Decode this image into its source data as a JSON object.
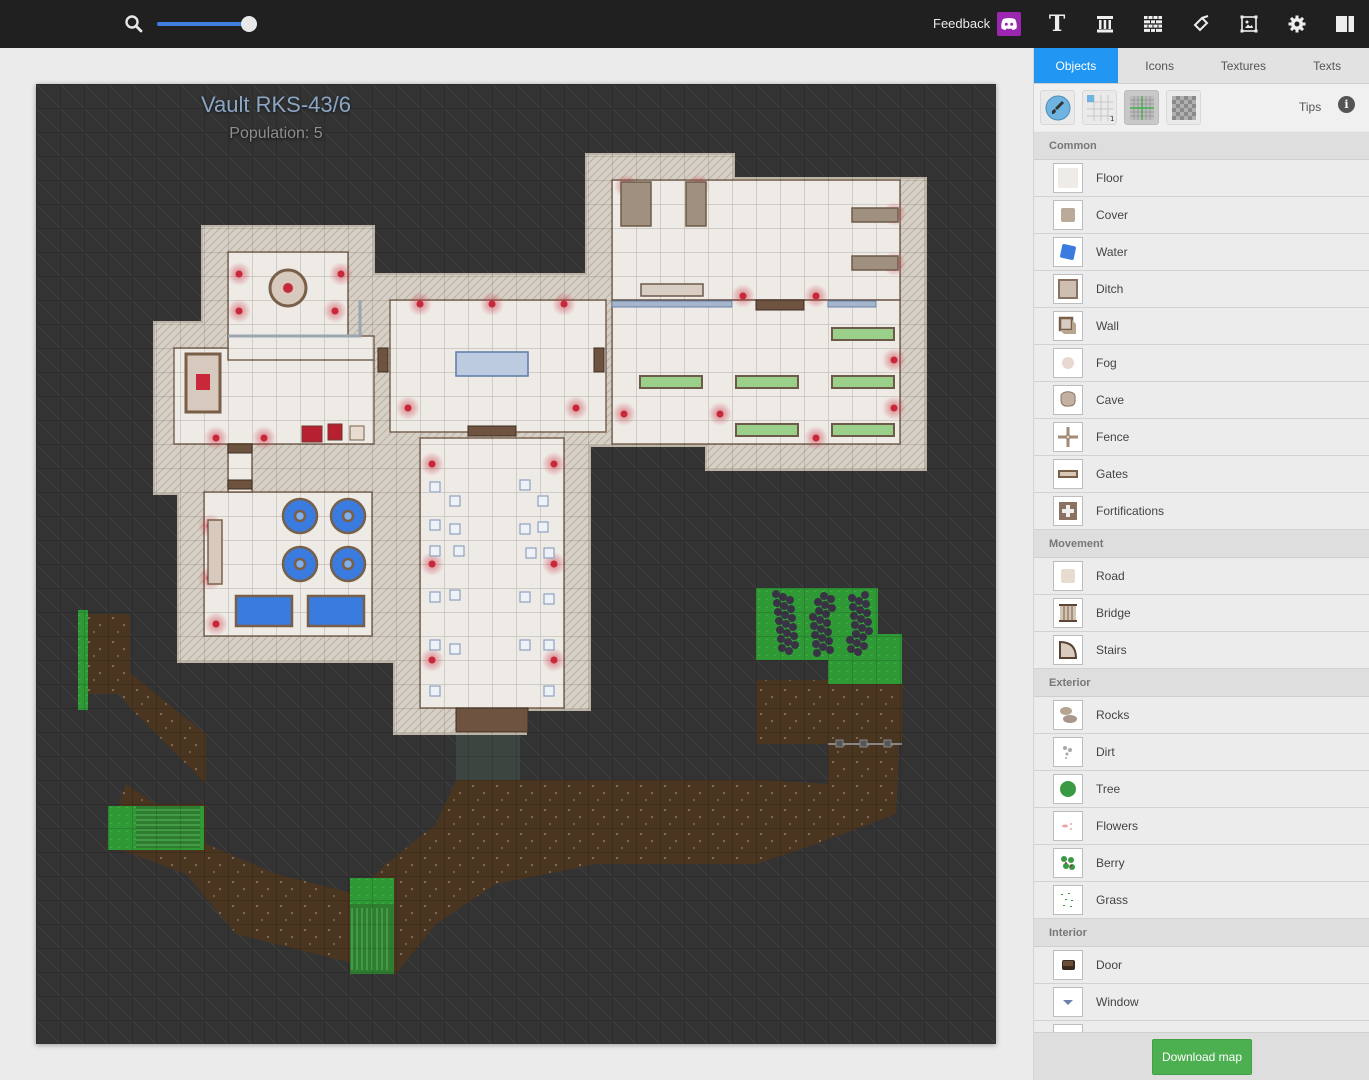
{
  "topbar": {
    "zoom_icon": "search-icon",
    "zoom_level_fraction": 0.92,
    "feedback_label": "Feedback",
    "discord_icon": "discord-icon",
    "tools": [
      {
        "name": "text-tool",
        "icon": "text-T-icon"
      },
      {
        "name": "style-tool",
        "icon": "column-icon"
      },
      {
        "name": "wall-tool",
        "icon": "brick-wall-icon"
      },
      {
        "name": "paint-tool",
        "icon": "paint-bucket-icon"
      },
      {
        "name": "image-tool",
        "icon": "image-frame-icon"
      },
      {
        "name": "settings-tool",
        "icon": "gear-icon"
      },
      {
        "name": "panel-toggle",
        "icon": "split-panel-icon"
      }
    ]
  },
  "map": {
    "title": "Vault RKS-43/6",
    "subtitle": "Population: 5"
  },
  "panel": {
    "tabs": [
      {
        "label": "Objects",
        "active": true
      },
      {
        "label": "Icons",
        "active": false
      },
      {
        "label": "Textures",
        "active": false
      },
      {
        "label": "Texts",
        "active": false
      }
    ],
    "tools": [
      {
        "name": "brush-tool",
        "icon": "brush-icon"
      },
      {
        "name": "snap-grid-tool",
        "icon": "grid-snap-icon",
        "badge": "1"
      },
      {
        "name": "grid-toggle",
        "icon": "grid-icon",
        "active": true
      },
      {
        "name": "transparency-toggle",
        "icon": "checkerboard-icon"
      }
    ],
    "tips_label": "Tips",
    "sections": [
      {
        "title": "Common",
        "items": [
          "Floor",
          "Cover",
          "Water",
          "Ditch",
          "Wall",
          "Fog",
          "Cave",
          "Fence",
          "Gates",
          "Fortifications"
        ]
      },
      {
        "title": "Movement",
        "items": [
          "Road",
          "Bridge",
          "Stairs"
        ]
      },
      {
        "title": "Exterior",
        "items": [
          "Rocks",
          "Dirt",
          "Tree",
          "Flowers",
          "Berry",
          "Grass"
        ]
      },
      {
        "title": "Interior",
        "items": [
          "Door",
          "Window",
          ""
        ]
      }
    ],
    "download_label": "Download map"
  }
}
